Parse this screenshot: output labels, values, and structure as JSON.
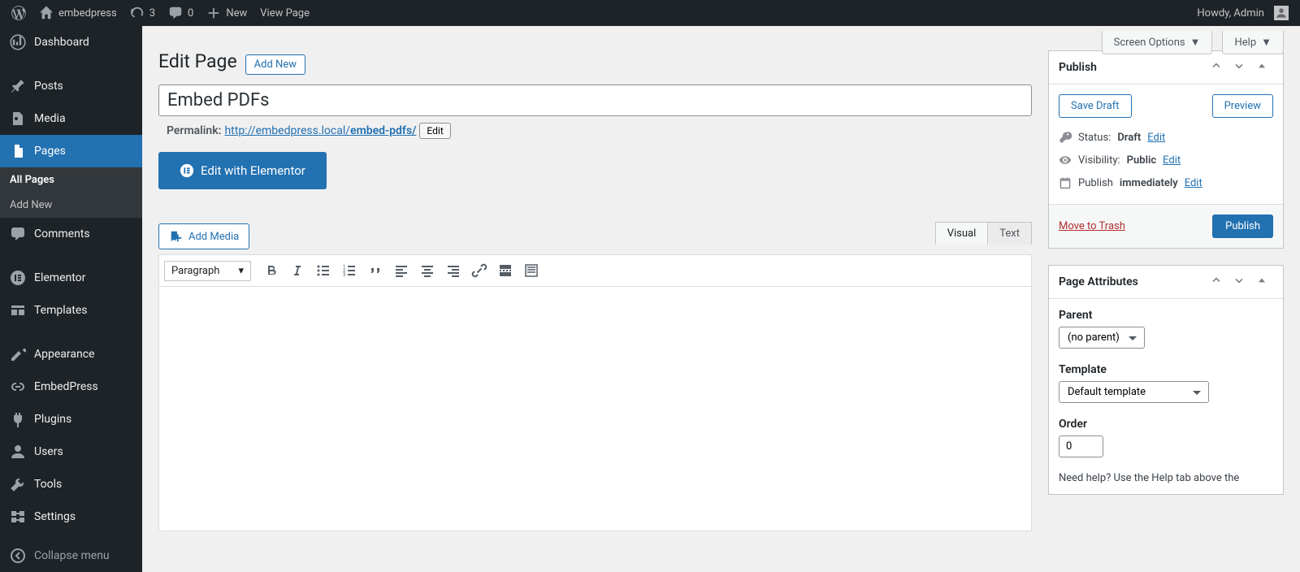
{
  "toolbar": {
    "site_name": "embedpress",
    "updates_count": "3",
    "comments_count": "0",
    "new_label": "New",
    "view_page_label": "View Page",
    "howdy_text": "Howdy, Admin"
  },
  "adminmenu": {
    "dashboard": "Dashboard",
    "posts": "Posts",
    "media": "Media",
    "pages": "Pages",
    "sub_all": "All Pages",
    "sub_addnew": "Add New",
    "comments": "Comments",
    "elementor": "Elementor",
    "templates": "Templates",
    "appearance": "Appearance",
    "embedpress": "EmbedPress",
    "plugins": "Plugins",
    "users": "Users",
    "tools": "Tools",
    "settings": "Settings",
    "collapse": "Collapse menu"
  },
  "screen_tabs": {
    "screen_options": "Screen Options",
    "help": "Help"
  },
  "heading": {
    "title": "Edit Page",
    "add_new": "Add New"
  },
  "editor": {
    "title_value": "Embed PDFs",
    "permalink_label": "Permalink:",
    "permalink_base": "http://embedpress.local/",
    "permalink_slug": "embed-pdfs/",
    "edit_btn": "Edit",
    "elementor_btn": "Edit with Elementor",
    "add_media": "Add Media",
    "tab_visual": "Visual",
    "tab_text": "Text",
    "format_select": "Paragraph"
  },
  "publish": {
    "box_title": "Publish",
    "save_draft": "Save Draft",
    "preview": "Preview",
    "status_label": "Status:",
    "status_value": "Draft",
    "visibility_label": "Visibility:",
    "visibility_value": "Public",
    "publish_label": "Publish",
    "publish_value": "immediately",
    "edit_link": "Edit",
    "trash": "Move to Trash",
    "publish_btn": "Publish"
  },
  "attributes": {
    "box_title": "Page Attributes",
    "parent_label": "Parent",
    "parent_value": "(no parent)",
    "template_label": "Template",
    "template_value": "Default template",
    "order_label": "Order",
    "order_value": "0",
    "help_text": "Need help? Use the Help tab above the"
  }
}
